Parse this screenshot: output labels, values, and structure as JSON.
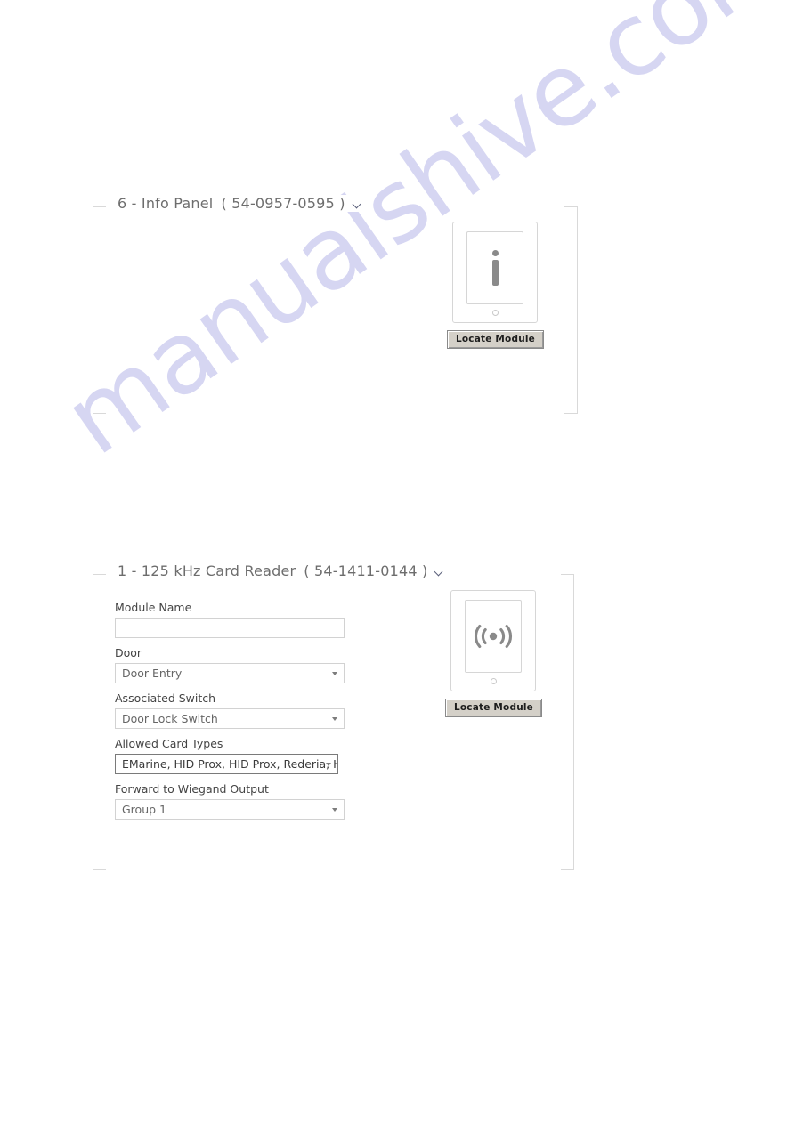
{
  "watermark": {
    "text": "manualshive.com"
  },
  "panels": [
    {
      "title_prefix": "6 - Info Panel",
      "serial": "( 54-0957-0595 )",
      "chevron_icon": "chevron-down-icon",
      "module_icon": "info-icon",
      "locate_label": "Locate Module",
      "fields": []
    },
    {
      "title_prefix": "1 - 125 kHz Card Reader",
      "serial": "( 54-1411-0144 )",
      "chevron_icon": "chevron-down-icon",
      "module_icon": "rfid-wave-icon",
      "locate_label": "Locate Module",
      "fields": [
        {
          "label": "Module Name",
          "type": "text",
          "value": "",
          "placeholder": ""
        },
        {
          "label": "Door",
          "type": "select",
          "value": "Door Entry"
        },
        {
          "label": "Associated Switch",
          "type": "select",
          "value": "Door Lock Switch"
        },
        {
          "label": "Allowed Card Types",
          "type": "select",
          "value": "EMarine, HID Prox, HID Prox, Rederia, H"
        },
        {
          "label": "Forward to Wiegand Output",
          "type": "select",
          "value": "Group 1"
        }
      ]
    }
  ],
  "colors": {
    "panel_border": "#d9d9d9",
    "title_text": "#6d6d6d",
    "label_text": "#444444",
    "select_text": "#666666",
    "button_face": "#d4d0c8",
    "watermark": "#cfcff0",
    "icon_gray": "#8a8a8a"
  }
}
